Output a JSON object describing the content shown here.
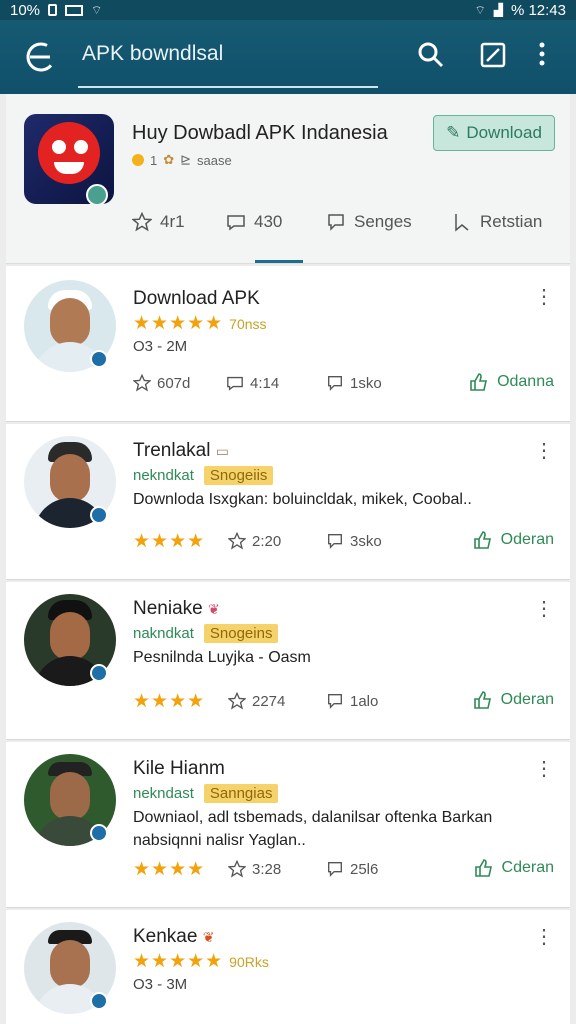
{
  "status_bar": {
    "left_text": "10%",
    "right_text": "% 12:43"
  },
  "app_bar": {
    "title": "APK bowndlsal"
  },
  "app_card": {
    "name": "Huy Dowbadl APK Indanesia",
    "sub_count": "1",
    "sub_meta": "saase",
    "download_label": "Download",
    "stats": [
      {
        "icon": "star-icon",
        "value": "4r1"
      },
      {
        "icon": "comment-icon",
        "value": "430"
      },
      {
        "icon": "bookmark-icon",
        "value": "Senges"
      },
      {
        "icon": "flag-icon",
        "value": "Retstian"
      }
    ]
  },
  "items": [
    {
      "name": "Download APK",
      "rating_text": "70nss",
      "sub": "O3 - 2M",
      "stat1": "607d",
      "stat2": "4:14",
      "stat3": "1sko",
      "order": "Odanna"
    },
    {
      "name": "Trenlakal",
      "tag": "nekndkat",
      "pill": "Snogeiis",
      "desc": "Downloda Isxgkan: boluincldak, mikek, Coobal..",
      "stat2": "2:20",
      "stat3": "3sko",
      "order": "Oderan"
    },
    {
      "name": "Neniake",
      "tag": "nakndkat",
      "pill": "Snogeins",
      "desc": "Pesnilnda Luyjka - Oasm",
      "stat2": "2274",
      "stat3": "1alo",
      "order": "Oderan"
    },
    {
      "name": "Kile Hianm",
      "tag": "nekndast",
      "pill": "Sanngias",
      "desc": "Downiaol, adl tsbemads, dalanilsar oftenka Barkan nabsiqnni nalisr Yaglan..",
      "stat2": "3:28",
      "stat3": "25l6",
      "order": "Cderan"
    },
    {
      "name": "Kenkae",
      "rating_text": "90Rks",
      "sub": "O3 - 3M"
    }
  ]
}
